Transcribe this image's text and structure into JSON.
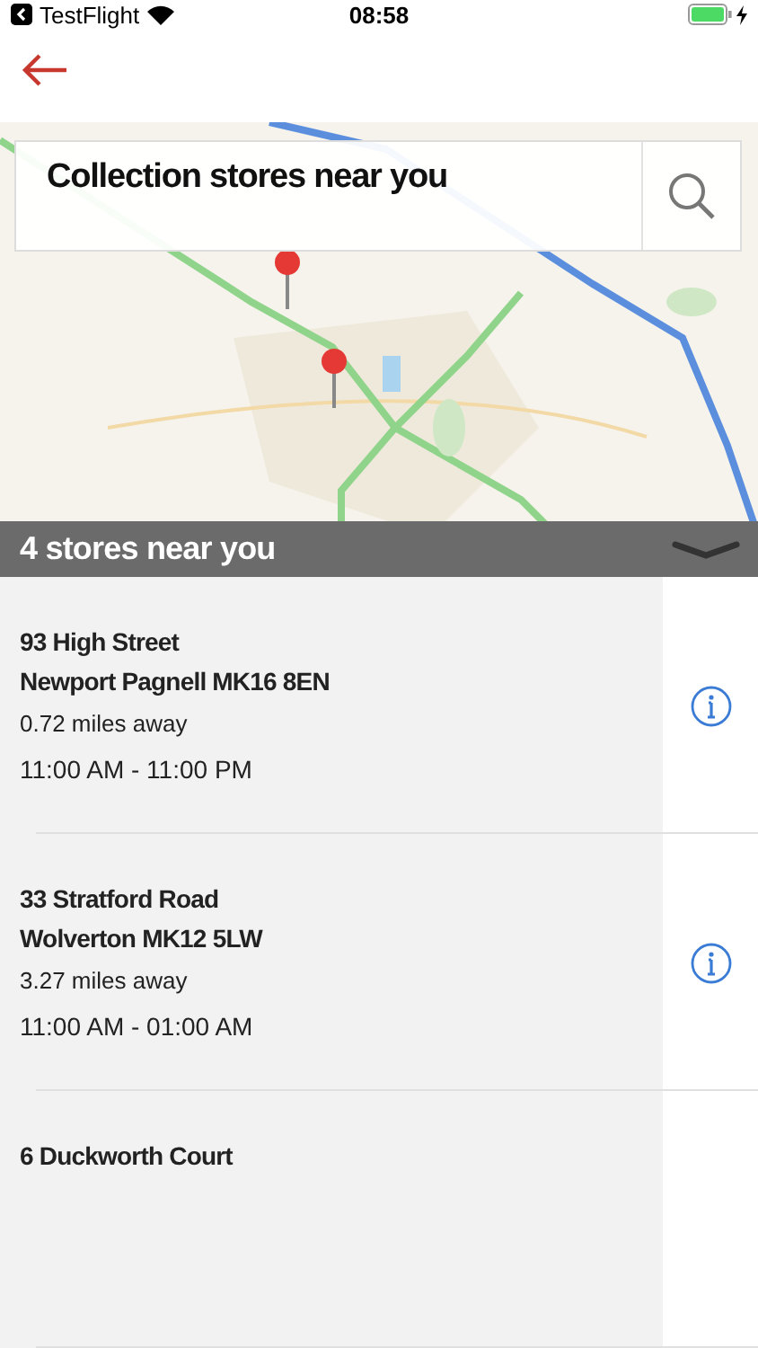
{
  "status_bar": {
    "back_app": "TestFlight",
    "time": "08:58"
  },
  "search_bar": {
    "title": "Collection stores near you"
  },
  "results_header": {
    "title": "4 stores near you"
  },
  "stores": [
    {
      "address_line_1": "93 High Street",
      "address_line_2": "Newport Pagnell MK16 8EN",
      "distance": "0.72 miles away",
      "hours": "11:00 AM - 11:00 PM"
    },
    {
      "address_line_1": "33 Stratford Road",
      "address_line_2": "Wolverton MK12 5LW",
      "distance": "3.27 miles away",
      "hours": "11:00 AM - 01:00 AM"
    },
    {
      "address_line_1": "6 Duckworth Court"
    }
  ]
}
